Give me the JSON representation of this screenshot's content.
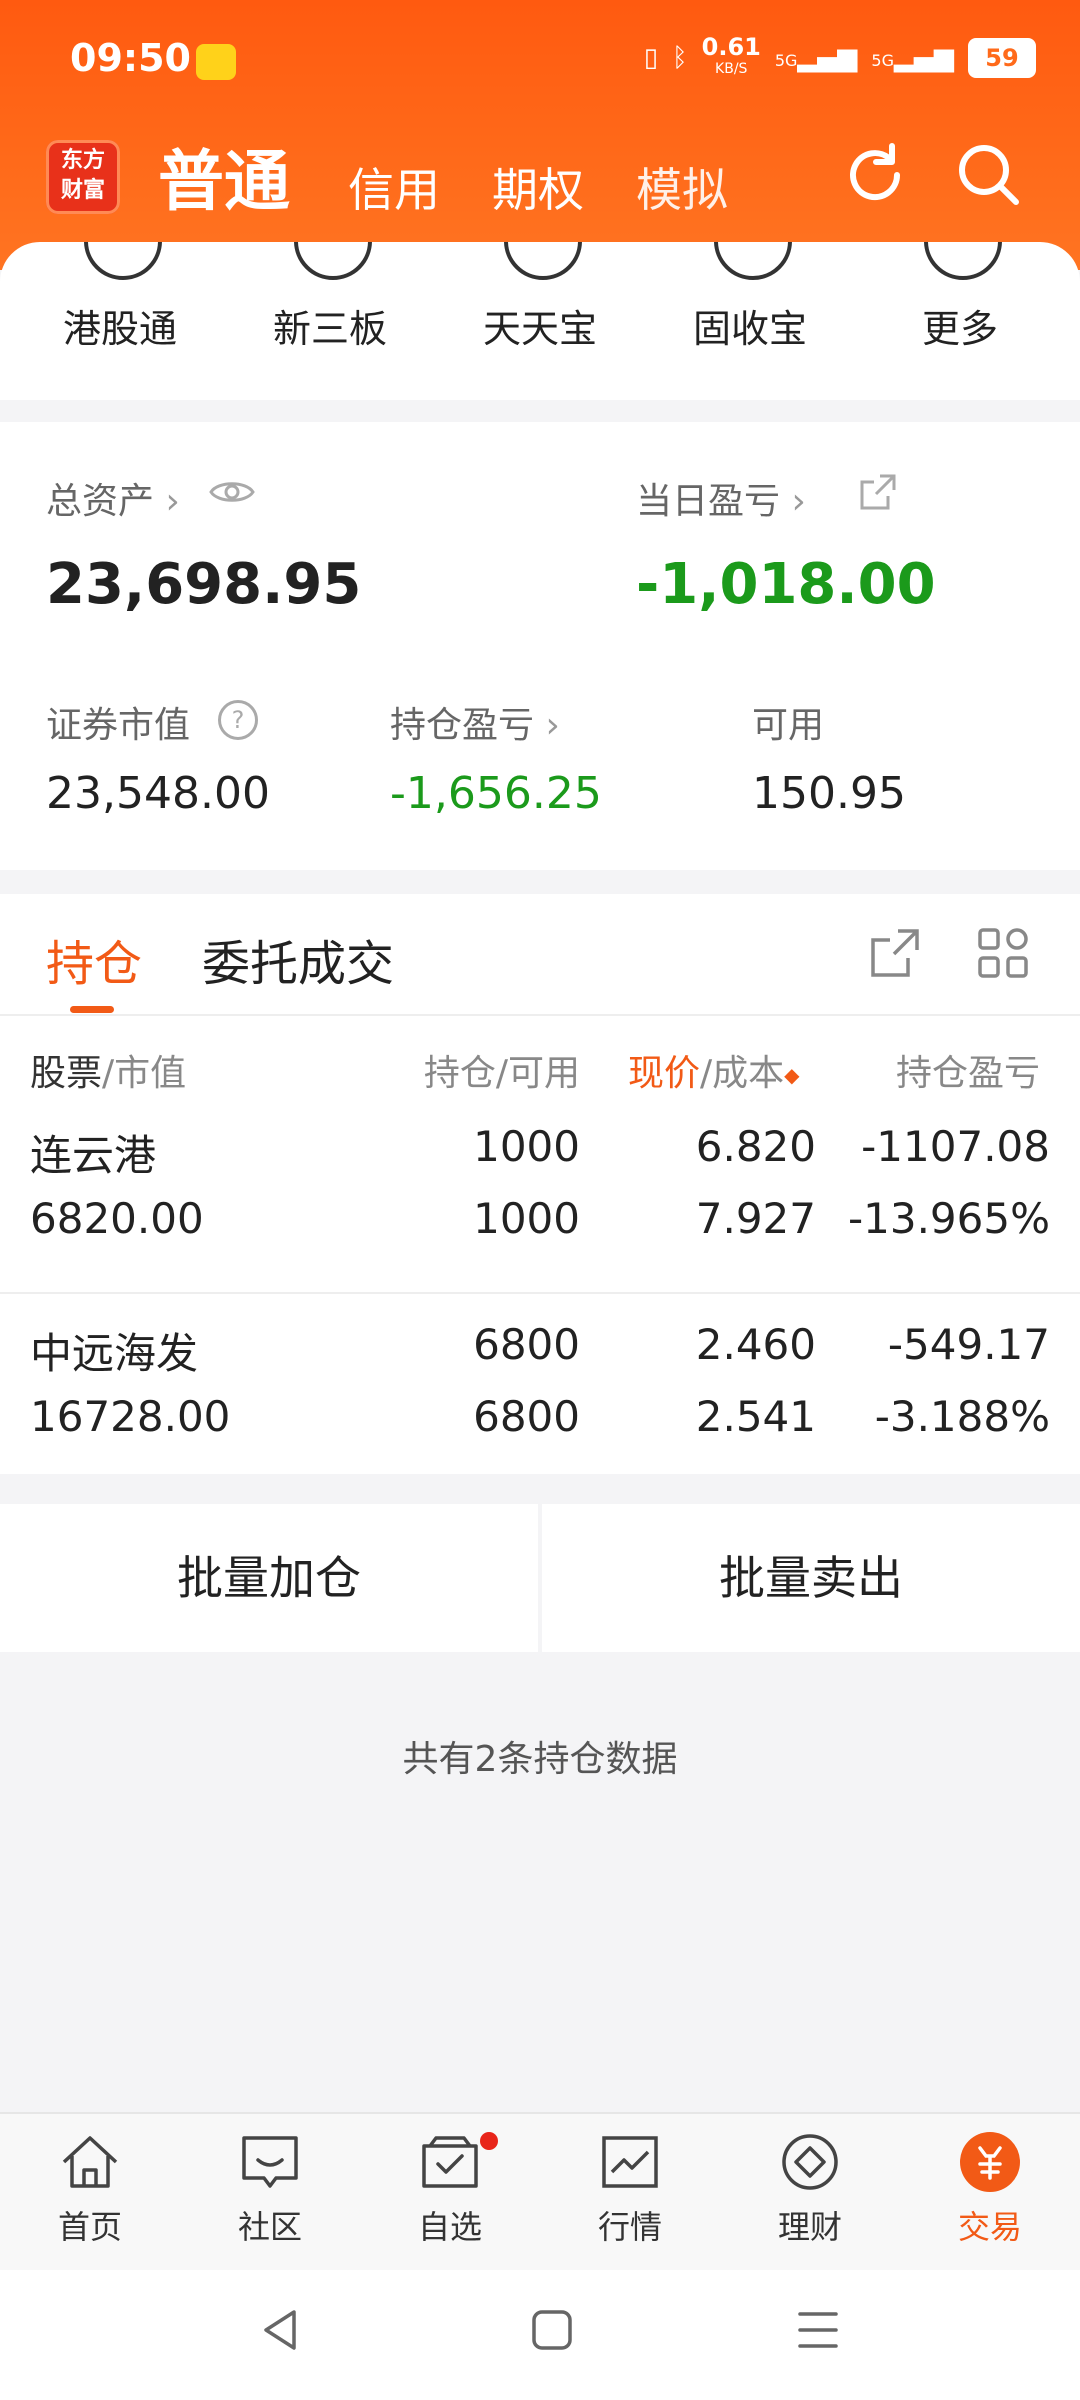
{
  "status": {
    "time": "09:50",
    "network_speed": "0.61",
    "network_unit": "KB/S",
    "sig1": "5G",
    "sig2": "5G",
    "battery": "59"
  },
  "header": {
    "logo_line1": "东方",
    "logo_line2": "财富",
    "tabs": [
      "普通",
      "信用",
      "期权",
      "模拟"
    ]
  },
  "shortcuts": [
    "港股通",
    "新三板",
    "天天宝",
    "固收宝",
    "更多"
  ],
  "assets": {
    "total_label": "总资产",
    "total_value": "23,698.95",
    "daily_label": "当日盈亏",
    "daily_value": "-1,018.00",
    "market_label": "证券市值",
    "market_value": "23,548.00",
    "position_pl_label": "持仓盈亏",
    "position_pl_value": "-1,656.25",
    "available_label": "可用",
    "available_value": "150.95"
  },
  "holdings": {
    "tabs": [
      "持仓",
      "委托成交"
    ],
    "columns": {
      "stock": "股票",
      "market": "/市值",
      "pos": "持仓/可用",
      "price": "现价",
      "cost": "/成本",
      "pl": "持仓盈亏"
    },
    "rows": [
      {
        "name": "连云港",
        "value": "6820.00",
        "pos": "1000",
        "avail": "1000",
        "price": "6.820",
        "cost": "7.927",
        "pl": "-1107.08",
        "pl_pct": "-13.965%"
      },
      {
        "name": "中远海发",
        "value": "16728.00",
        "pos": "6800",
        "avail": "6800",
        "price": "2.460",
        "cost": "2.541",
        "pl": "-549.17",
        "pl_pct": "-3.188%"
      }
    ]
  },
  "batch": {
    "add": "批量加仓",
    "sell": "批量卖出"
  },
  "summary": "共有2条持仓数据",
  "nav": [
    "首页",
    "社区",
    "自选",
    "行情",
    "理财",
    "交易"
  ],
  "colors": {
    "accent": "#f25a16",
    "loss": "#1b9a1b"
  }
}
